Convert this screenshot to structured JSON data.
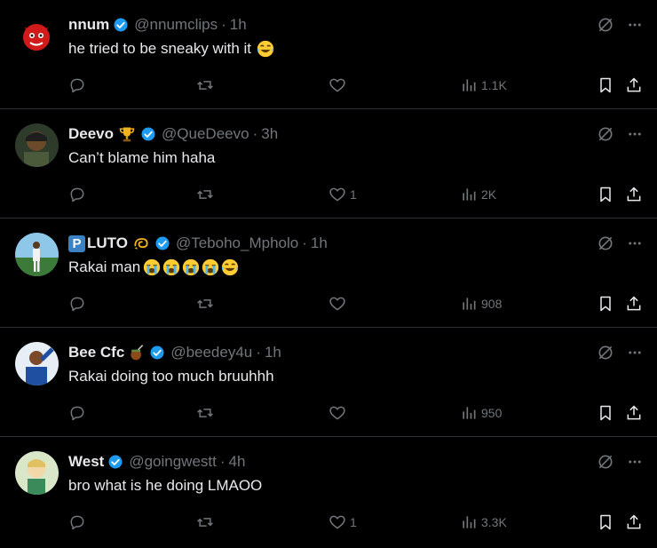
{
  "tweets": [
    {
      "name": "nnum",
      "handle": "@nnumclips",
      "time": "1h",
      "text": "he tried to be sneaky with it",
      "text_emojis": [
        "face-with-tears-of-joy"
      ],
      "decorations": [],
      "reply_count": "",
      "retweet_count": "",
      "like_count": "",
      "views": "1.1K",
      "avatar_color": "#d11a1a"
    },
    {
      "name": "Deevo",
      "handle": "@QueDeevo",
      "time": "3h",
      "text": "Can’t blame him haha",
      "text_emojis": [],
      "decorations": [
        "trophy"
      ],
      "reply_count": "",
      "retweet_count": "",
      "like_count": "1",
      "views": "2K",
      "avatar_color": "#4a5a3a"
    },
    {
      "name": "LUTO",
      "name_prefix_letter": "P",
      "handle": "@Teboho_Mpholo",
      "time": "1h",
      "text": "Rakai man",
      "text_emojis": [
        "loudly-crying-face",
        "loudly-crying-face",
        "loudly-crying-face",
        "loudly-crying-face",
        "face-with-tears-of-joy"
      ],
      "decorations": [
        "dizzy"
      ],
      "reply_count": "",
      "retweet_count": "",
      "like_count": "",
      "views": "908",
      "avatar_color": "#3c7a3a"
    },
    {
      "name": "Bee Cfc",
      "handle": "@beedey4u",
      "time": "1h",
      "text": "Rakai doing too much bruuhhh",
      "text_emojis": [],
      "decorations": [
        "mate-drink"
      ],
      "reply_count": "",
      "retweet_count": "",
      "like_count": "",
      "views": "950",
      "avatar_color": "#1f4fa0"
    },
    {
      "name": "West",
      "handle": "@goingwestt",
      "time": "4h",
      "text": "bro what is he doing LMAOO",
      "text_emojis": [],
      "decorations": [],
      "reply_count": "",
      "retweet_count": "",
      "like_count": "1",
      "views": "3.3K",
      "avatar_color": "#c9c17a"
    }
  ],
  "separator": "·",
  "colors": {
    "background": "#000000",
    "text": "#e7e9ea",
    "muted": "#71767b",
    "verified": "#1d9bf0",
    "divider": "#2f3336"
  },
  "icons": {
    "verified": "verified-badge-icon",
    "reply": "reply-icon",
    "retweet": "retweet-icon",
    "like": "heart-icon",
    "views": "views-bar-chart-icon",
    "bookmark": "bookmark-icon",
    "share": "share-icon",
    "grok": "grok-icon",
    "more": "more-dots-icon"
  }
}
